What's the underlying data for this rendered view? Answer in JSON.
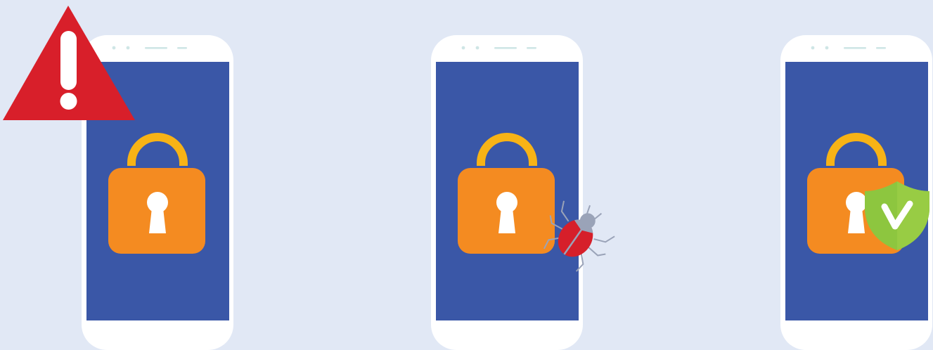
{
  "colors": {
    "background": "#E1E8F5",
    "phone_body": "#FFFFFF",
    "phone_screen": "#3A57A7",
    "phone_sensor": "#CFE6E6",
    "lock_shackle": "#F7B316",
    "lock_body": "#F48B21",
    "keyhole": "#FFFFFF",
    "warning_red": "#D81F2A",
    "bug_red": "#D61F2A",
    "bug_gray": "#9AA3B8",
    "shield_green": "#8DC63F",
    "shield_green_light": "#A2D149"
  },
  "phones": [
    {
      "id": "warning",
      "badge": "warning-triangle",
      "badge_icon": "warning-icon"
    },
    {
      "id": "infected",
      "badge": "bug",
      "badge_icon": "bug-icon"
    },
    {
      "id": "protected",
      "badge": "shield-check",
      "badge_icon": "shield-check-icon"
    }
  ]
}
